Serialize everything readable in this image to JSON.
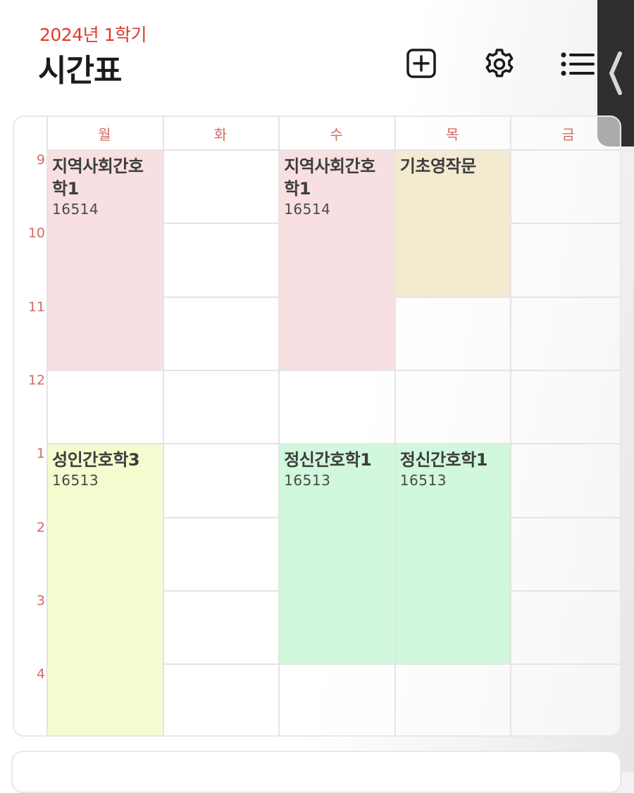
{
  "header": {
    "semester": "2024년 1학기",
    "title": "시간표"
  },
  "toolbar": {
    "add_icon": "plus-square-icon",
    "settings_icon": "gear-icon",
    "list_icon": "list-icon",
    "side_handle_icon": "chevron-left-icon"
  },
  "grid": {
    "days": [
      "월",
      "화",
      "수",
      "목",
      "금"
    ],
    "hours": [
      "9",
      "10",
      "11",
      "12",
      "1",
      "2",
      "3",
      "4"
    ]
  },
  "courses": [
    {
      "name": "지역사회간호학1",
      "room": "16514",
      "day": "월",
      "start": "9",
      "periods": 3,
      "color": "#f7dfe2"
    },
    {
      "name": "지역사회간호학1",
      "room": "16514",
      "day": "수",
      "start": "9",
      "periods": 3,
      "color": "#f7dfe2"
    },
    {
      "name": "기초영작문",
      "room": "",
      "day": "목",
      "start": "9",
      "periods": 2,
      "color": "#f3ead0"
    },
    {
      "name": "성인간호학3",
      "room": "16513",
      "day": "월",
      "start": "1",
      "periods": 4,
      "color": "#f4fbcf"
    },
    {
      "name": "정신간호학1",
      "room": "16513",
      "day": "수",
      "start": "1",
      "periods": 3,
      "color": "#d1f7dc"
    },
    {
      "name": "정신간호학1",
      "room": "16513",
      "day": "목",
      "start": "1",
      "periods": 3,
      "color": "#d1f7dc"
    }
  ],
  "colors": {
    "accent_red": "#e03a2c",
    "label_red": "#d16b63",
    "handle_dark": "#2f2f2f"
  }
}
